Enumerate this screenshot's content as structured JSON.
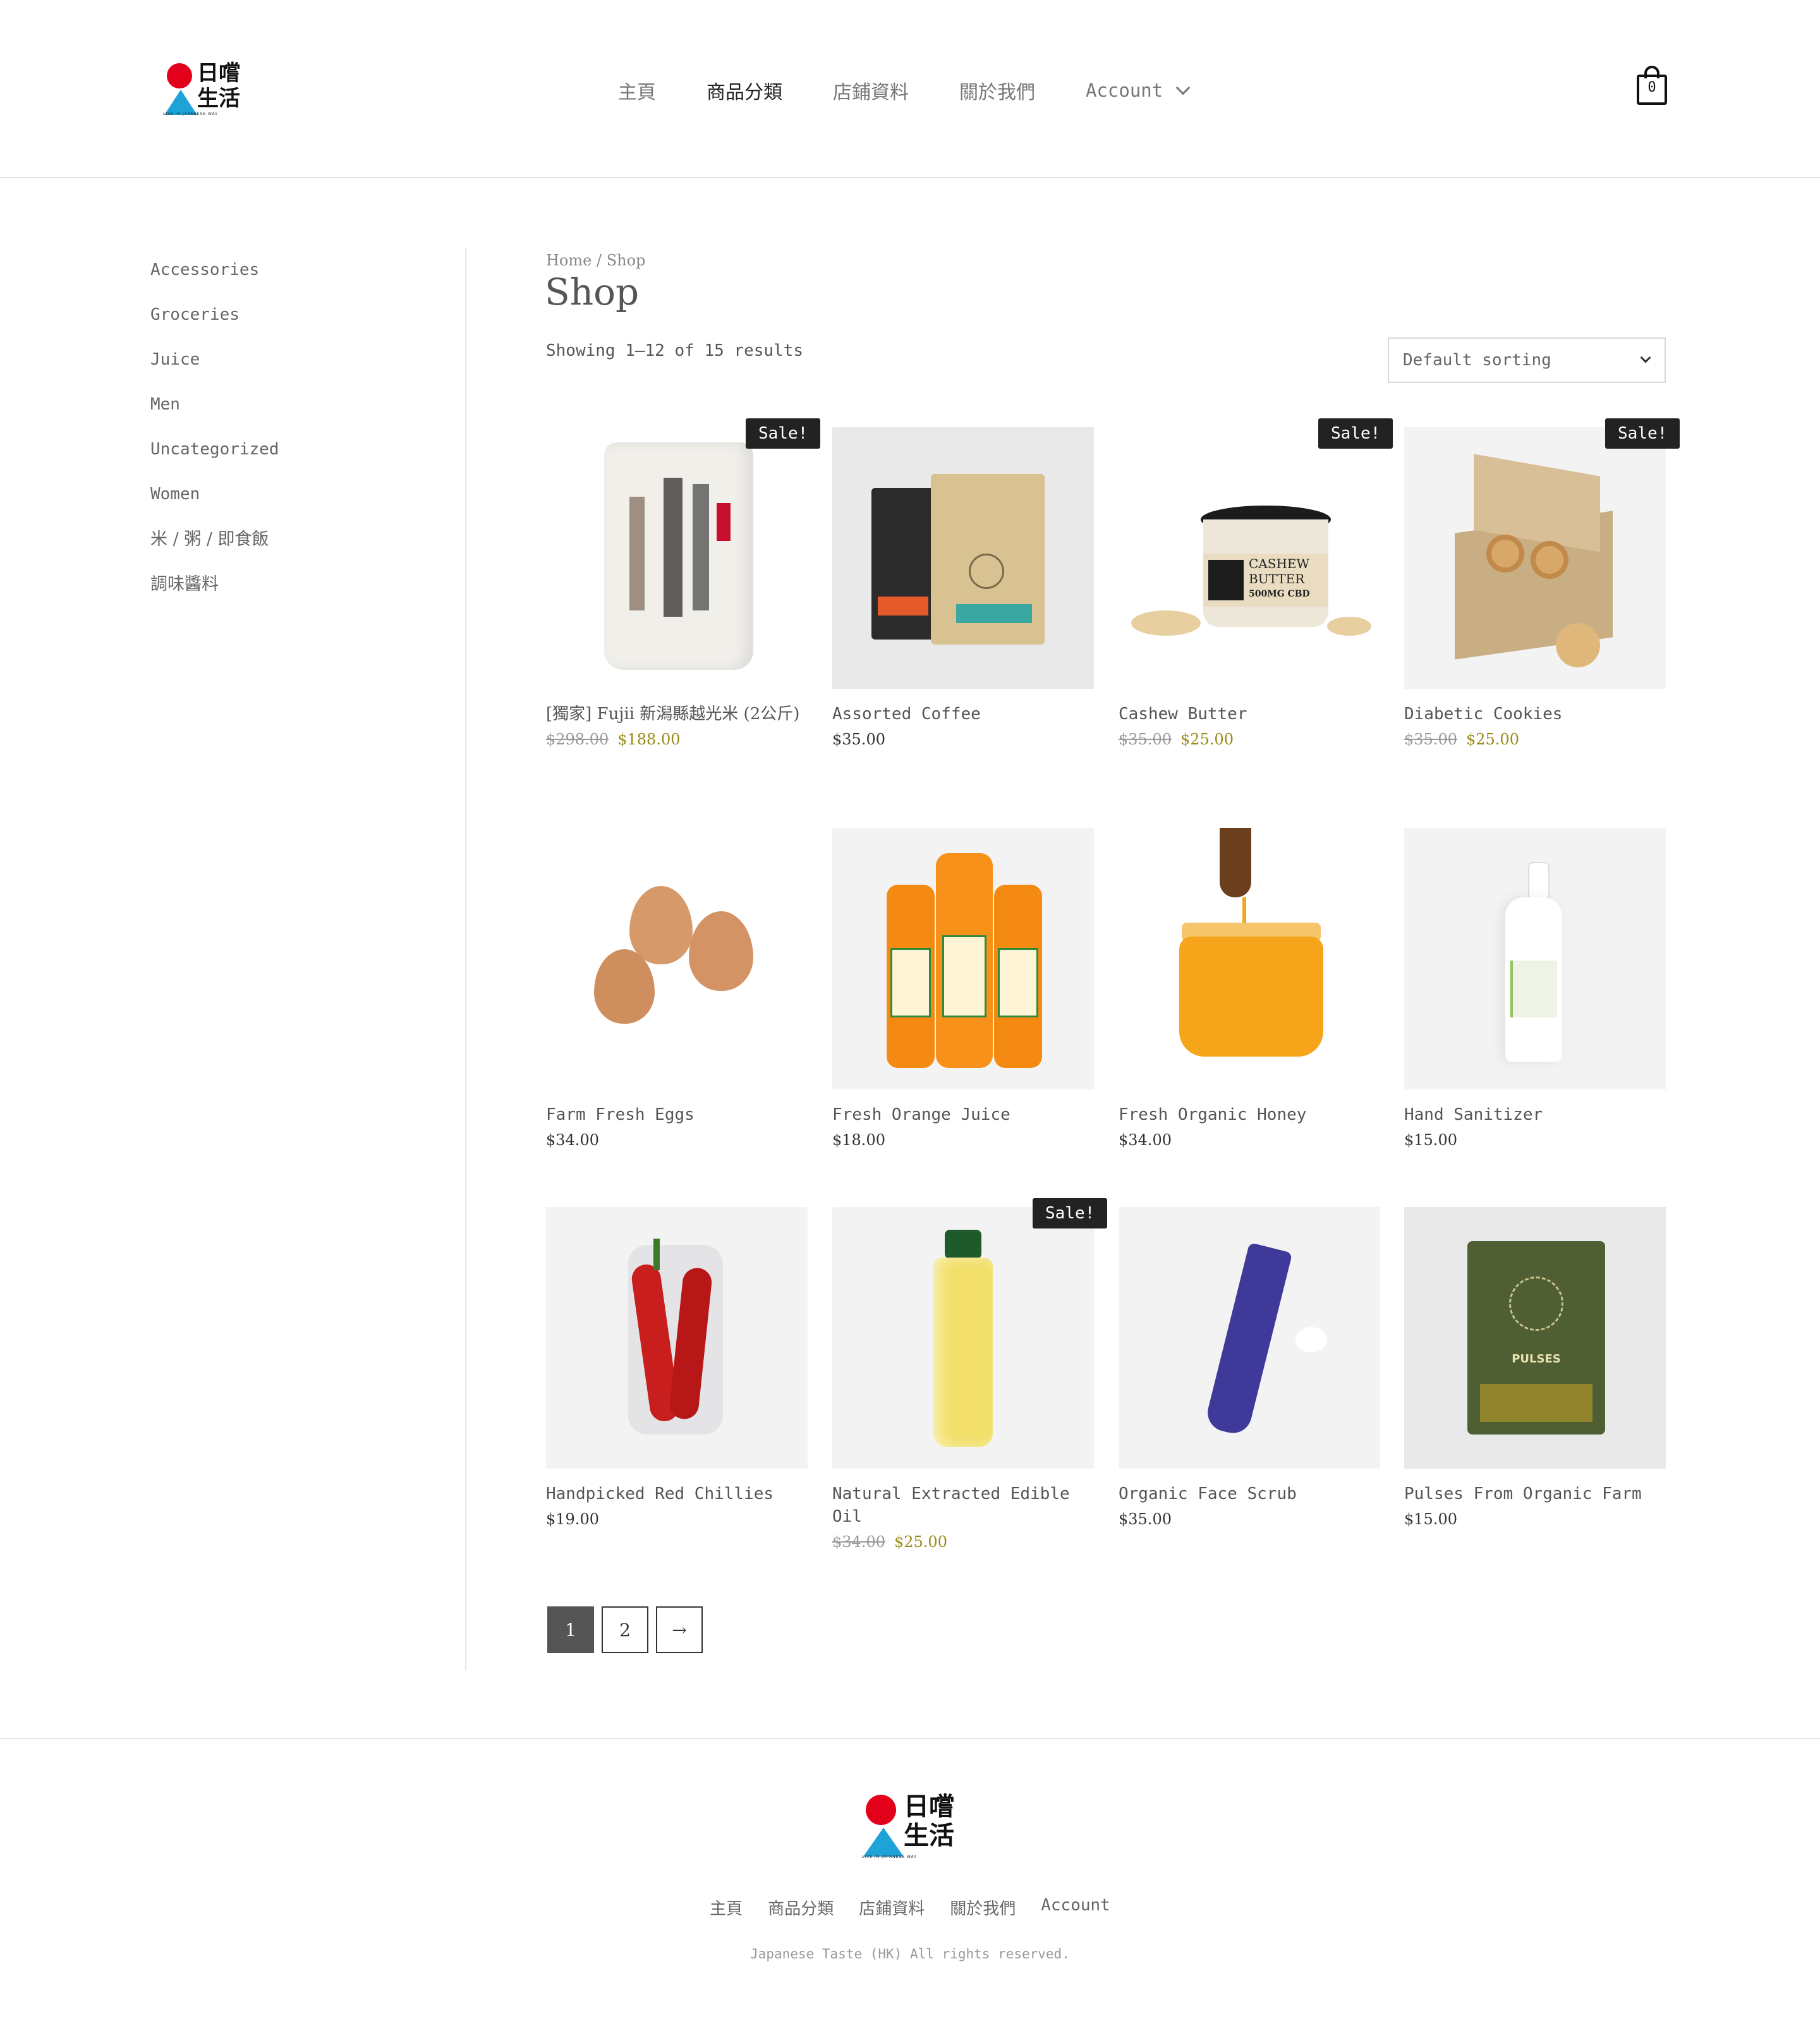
{
  "header": {
    "logo": {
      "kanji_top": "日嚐",
      "kanji_bottom": "生活",
      "tagline": "LIVE IN JAPANESE WAY"
    },
    "nav": [
      {
        "label": "主頁"
      },
      {
        "label": "商品分類"
      },
      {
        "label": "店鋪資料"
      },
      {
        "label": "關於我們"
      }
    ],
    "account_label": "Account",
    "cart_count": "0"
  },
  "sidebar": {
    "categories": [
      {
        "label": "Accessories"
      },
      {
        "label": "Groceries"
      },
      {
        "label": "Juice"
      },
      {
        "label": "Men"
      },
      {
        "label": "Uncategorized"
      },
      {
        "label": "Women"
      },
      {
        "label": "米 / 粥 / 即食飯"
      },
      {
        "label": "調味醬料"
      }
    ]
  },
  "main": {
    "breadcrumb": {
      "home": "Home",
      "separator": " / ",
      "current": "Shop"
    },
    "title": "Shop",
    "result_count": "Showing 1–12 of 15 results",
    "sort": {
      "selected": "Default sorting"
    },
    "sale_label": "Sale!",
    "products": [
      {
        "name": "[獨家] Fujii 新潟縣越光米 (2公斤)",
        "old_price": "$298.00",
        "price": "$188.00",
        "on_sale": true
      },
      {
        "name": "Assorted Coffee",
        "price": "$35.00",
        "on_sale": false
      },
      {
        "name": "Cashew Butter",
        "old_price": "$35.00",
        "price": "$25.00",
        "on_sale": true,
        "label_text": [
          "CASHEW",
          "BUTTER",
          "500MG CBD"
        ]
      },
      {
        "name": "Diabetic Cookies",
        "old_price": "$35.00",
        "price": "$25.00",
        "on_sale": true
      },
      {
        "name": "Farm Fresh Eggs",
        "price": "$34.00",
        "on_sale": false
      },
      {
        "name": "Fresh Orange Juice",
        "price": "$18.00",
        "on_sale": false
      },
      {
        "name": "Fresh Organic Honey",
        "price": "$34.00",
        "on_sale": false
      },
      {
        "name": "Hand Sanitizer",
        "price": "$15.00",
        "on_sale": false
      },
      {
        "name": "Handpicked Red Chillies",
        "price": "$19.00",
        "on_sale": false
      },
      {
        "name": "Natural Extracted Edible Oil",
        "old_price": "$34.00",
        "price": "$25.00",
        "on_sale": true
      },
      {
        "name": "Organic Face Scrub",
        "price": "$35.00",
        "on_sale": false
      },
      {
        "name": "Pulses From Organic Farm",
        "price": "$15.00",
        "on_sale": false,
        "label_text": "PULSES"
      }
    ]
  },
  "pagination": {
    "pages": [
      "1",
      "2"
    ],
    "current": "1",
    "next_label": "→"
  },
  "footer": {
    "nav": [
      {
        "label": "主頁"
      },
      {
        "label": "商品分類"
      },
      {
        "label": "店鋪資料"
      },
      {
        "label": "關於我們"
      },
      {
        "label": "Account"
      }
    ],
    "copyright": "Japanese Taste (HK) All rights reserved."
  },
  "colors": {
    "sale_badge": "#222222",
    "sale_price": "#9a8a18",
    "logo_red": "#e2001a",
    "logo_blue": "#1ea3d8"
  }
}
